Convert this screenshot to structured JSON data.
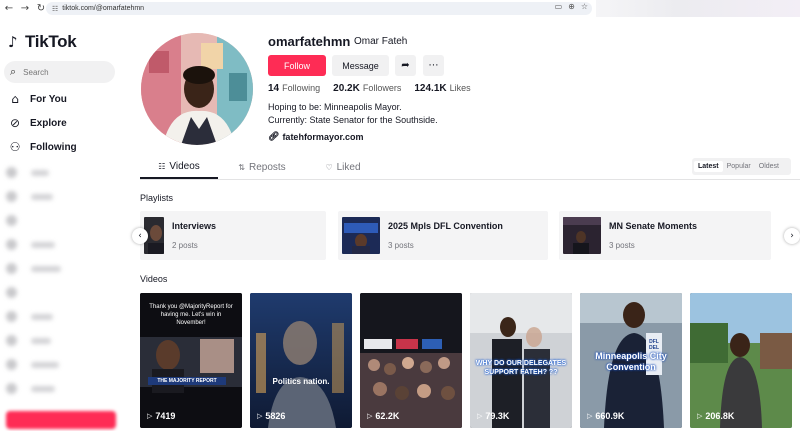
{
  "browser": {
    "url": "tiktok.com/@omarfatehmn",
    "back": "←",
    "forward": "→",
    "reload": "↻",
    "site_icon": "☷"
  },
  "sidebar": {
    "logo": "TikTok",
    "search_placeholder": "Search",
    "nav": [
      {
        "label": "For You",
        "icon": "home-icon"
      },
      {
        "label": "Explore",
        "icon": "compass-icon"
      },
      {
        "label": "Following",
        "icon": "user-add-icon"
      }
    ]
  },
  "profile": {
    "username": "omarfatehmn",
    "display_name": "Omar Fateh",
    "follow_label": "Follow",
    "message_label": "Message",
    "stats": [
      {
        "value": "14",
        "label": "Following"
      },
      {
        "value": "20.2K",
        "label": "Followers"
      },
      {
        "value": "124.1K",
        "label": "Likes"
      }
    ],
    "bio_lines": [
      "Hoping to be: Minneapolis Mayor.",
      "Currently: State Senator for the Southside."
    ],
    "link": "fatehformayor.com"
  },
  "tabs": [
    {
      "label": "Videos",
      "active": true
    },
    {
      "label": "Reposts",
      "active": false
    },
    {
      "label": "Liked",
      "active": false
    }
  ],
  "sort": [
    "Latest",
    "Popular",
    "Oldest"
  ],
  "playlists": {
    "title": "Playlists",
    "items": [
      {
        "title": "Interviews",
        "count": "2 posts"
      },
      {
        "title": "2025 Mpls DFL Convention",
        "count": "3 posts"
      },
      {
        "title": "MN Senate Moments",
        "count": "3 posts"
      }
    ]
  },
  "videos": {
    "title": "Videos",
    "items": [
      {
        "views": "7419",
        "caption": "Thank you @MajorityReport for having me. Let's win in November!",
        "tag": "THE MAJORITY REPORT"
      },
      {
        "views": "5826",
        "caption": "Politics nation."
      },
      {
        "views": "62.2K",
        "caption": ""
      },
      {
        "views": "79.3K",
        "caption": "WHY DO OUR DELEGATES SUPPORT FATEH? ??"
      },
      {
        "views": "660.9K",
        "caption": "Minneapolis City Convention",
        "badge": "DFL DEL"
      },
      {
        "views": "206.8K",
        "caption": ""
      }
    ]
  },
  "colors": {
    "accent": "#fe2c55",
    "text": "#161823",
    "muted": "#73747b"
  }
}
